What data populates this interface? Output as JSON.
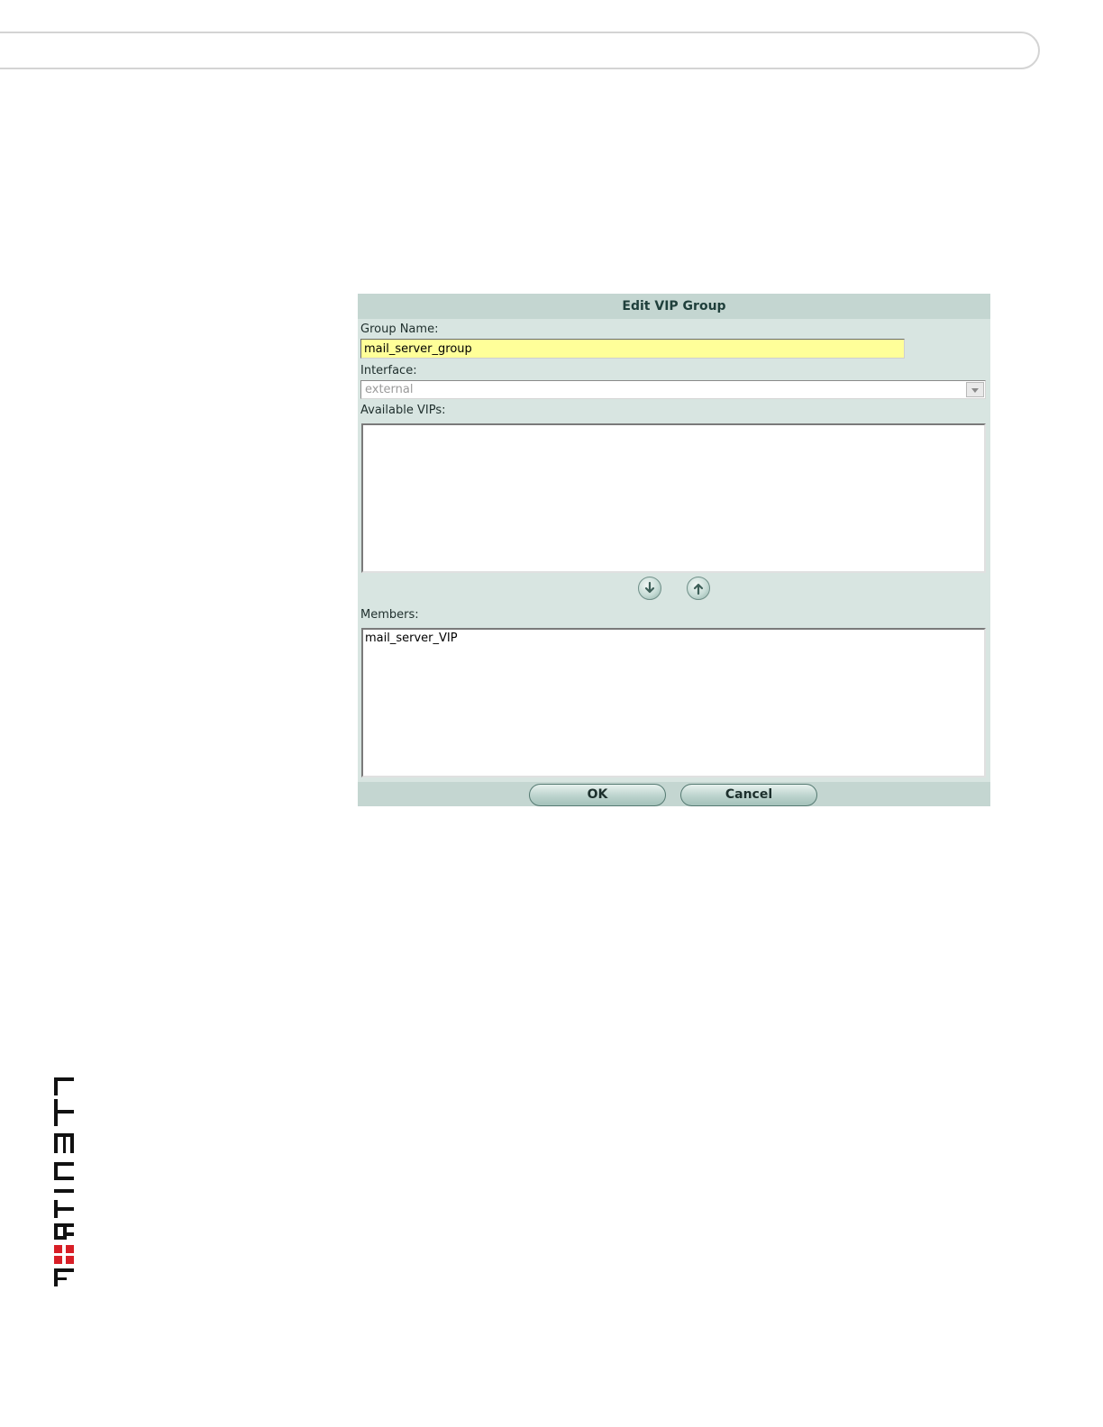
{
  "dialog": {
    "title": "Edit VIP Group",
    "group_name_label": "Group Name:",
    "group_name_value": "mail_server_group",
    "interface_label": "Interface:",
    "interface_value": "external",
    "available_label": "Available VIPs:",
    "available_items": [],
    "members_label": "Members:",
    "members_items": [
      "mail_server_VIP"
    ],
    "ok_label": "OK",
    "cancel_label": "Cancel"
  },
  "logo": {
    "text": "FORTINET",
    "colors": {
      "letters": "#111111",
      "accent": "#d81e26"
    }
  },
  "colors": {
    "dialog_bg": "#d8e5e1",
    "title_bg": "#c4d6d1",
    "input_highlight": "#ffff99"
  }
}
